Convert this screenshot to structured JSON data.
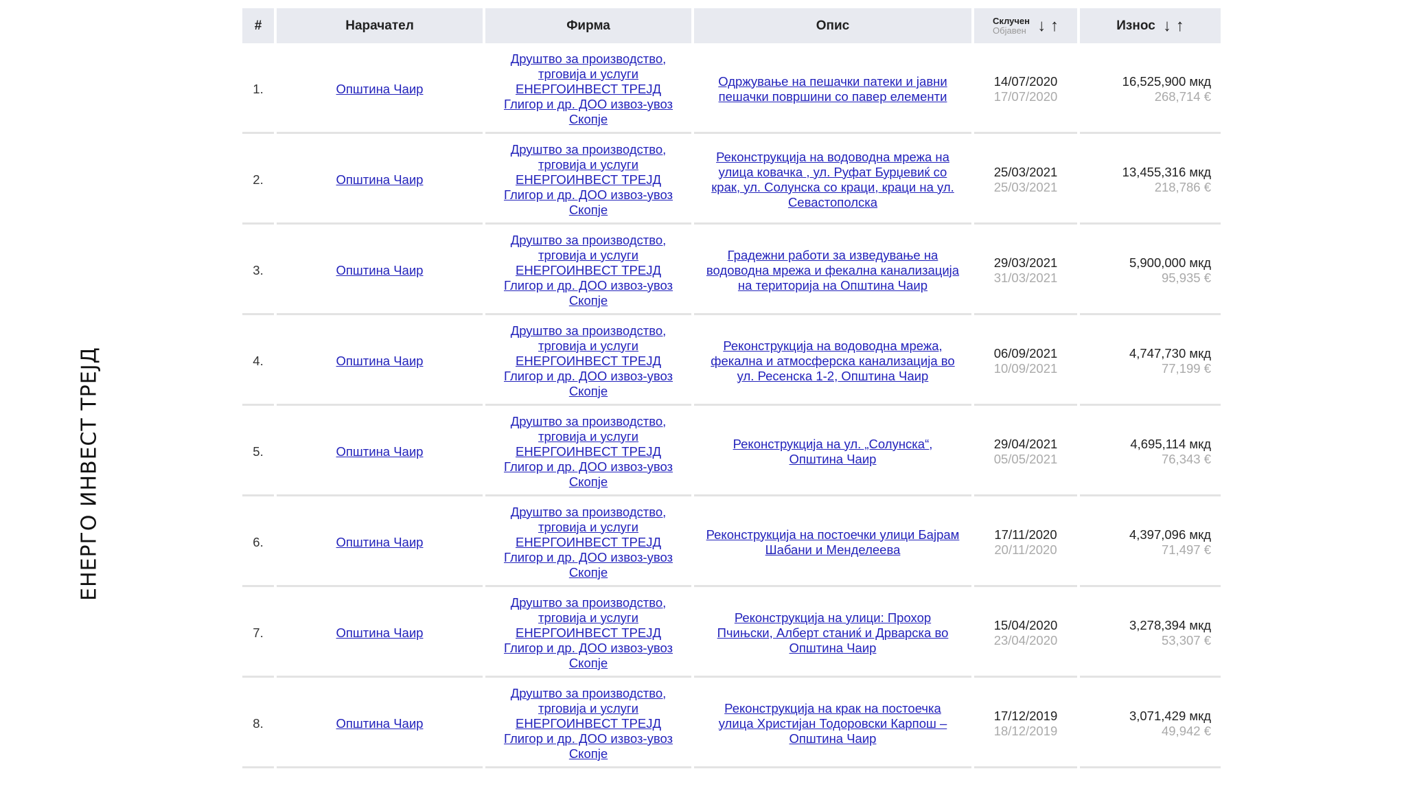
{
  "side_title": "ЕНЕРГО ИНВЕСТ ТРЕЈД",
  "headers": {
    "num": "#",
    "buyer": "Нарачател",
    "firm": "Фирма",
    "desc": "Опис",
    "date_main": "Склучен",
    "date_sub": "Објавен",
    "amount": "Износ",
    "arrow_down": "↓",
    "arrow_up": "↑"
  },
  "rows": [
    {
      "num": "1.",
      "buyer": "Општина Чаир",
      "firm": [
        "Друштво за производство,",
        "трговија и услуги",
        "ЕНЕРГОИНВЕСТ ТРЕЈД",
        "Глигор и др. ДОО извоз-увоз",
        "Скопје"
      ],
      "desc": [
        "Одржување на пешачки патеки и јавни",
        "пешачки површини со павер елементи"
      ],
      "signed": "14/07/2020",
      "published": "17/07/2020",
      "amount_mkd": "16,525,900 мкд",
      "amount_eur": "268,714 €"
    },
    {
      "num": "2.",
      "buyer": "Општина Чаир",
      "firm": [
        "Друштво за производство,",
        "трговија и услуги",
        "ЕНЕРГОИНВЕСТ ТРЕЈД",
        "Глигор и др. ДОО извоз-увоз",
        "Скопје"
      ],
      "desc": [
        "Реконструкција на водоводна мрежа на",
        "улица ковачка , ул. Руфат Бурџевиќ со",
        "крак, ул. Солунска со краци, краци на ул.",
        "Севастополска"
      ],
      "signed": "25/03/2021",
      "published": "25/03/2021",
      "amount_mkd": "13,455,316 мкд",
      "amount_eur": "218,786 €"
    },
    {
      "num": "3.",
      "buyer": "Општина Чаир",
      "firm": [
        "Друштво за производство,",
        "трговија и услуги",
        "ЕНЕРГОИНВЕСТ ТРЕЈД",
        "Глигор и др. ДОО извоз-увоз",
        "Скопје"
      ],
      "desc": [
        "Градежни работи за изведување на",
        "водоводна мрежа и фекална канализација",
        "на територија на Општина Чаир"
      ],
      "signed": "29/03/2021",
      "published": "31/03/2021",
      "amount_mkd": "5,900,000 мкд",
      "amount_eur": "95,935 €"
    },
    {
      "num": "4.",
      "buyer": "Општина Чаир",
      "firm": [
        "Друштво за производство,",
        "трговија и услуги",
        "ЕНЕРГОИНВЕСТ ТРЕЈД",
        "Глигор и др. ДОО извоз-увоз",
        "Скопје"
      ],
      "desc": [
        "Реконструкција на водоводна мрежа,",
        "фекална и атмосферска канализација во",
        "ул. Ресенска 1-2, Општина Чаир"
      ],
      "signed": "06/09/2021",
      "published": "10/09/2021",
      "amount_mkd": "4,747,730 мкд",
      "amount_eur": "77,199 €"
    },
    {
      "num": "5.",
      "buyer": "Општина Чаир",
      "firm": [
        "Друштво за производство,",
        "трговија и услуги",
        "ЕНЕРГОИНВЕСТ ТРЕЈД",
        "Глигор и др. ДОО извоз-увоз",
        "Скопје"
      ],
      "desc": [
        "Реконструкција на ул. „Солунска“,",
        "Општина Чаир"
      ],
      "signed": "29/04/2021",
      "published": "05/05/2021",
      "amount_mkd": "4,695,114 мкд",
      "amount_eur": "76,343 €"
    },
    {
      "num": "6.",
      "buyer": "Општина Чаир",
      "firm": [
        "Друштво за производство,",
        "трговија и услуги",
        "ЕНЕРГОИНВЕСТ ТРЕЈД",
        "Глигор и др. ДОО извоз-увоз",
        "Скопје"
      ],
      "desc": [
        "Реконструкција на постоечки улици Бајрам",
        "Шабани и Менделеева"
      ],
      "signed": "17/11/2020",
      "published": "20/11/2020",
      "amount_mkd": "4,397,096 мкд",
      "amount_eur": "71,497 €"
    },
    {
      "num": "7.",
      "buyer": "Општина Чаир",
      "firm": [
        "Друштво за производство,",
        "трговија и услуги",
        "ЕНЕРГОИНВЕСТ ТРЕЈД",
        "Глигор и др. ДОО извоз-увоз",
        "Скопје"
      ],
      "desc": [
        "Реконструкција на улици: Прохор",
        "Пчињски, Алберт станиќ и Дрварска во",
        "Општина Чаир"
      ],
      "signed": "15/04/2020",
      "published": "23/04/2020",
      "amount_mkd": "3,278,394 мкд",
      "amount_eur": "53,307 €"
    },
    {
      "num": "8.",
      "buyer": "Општина Чаир",
      "firm": [
        "Друштво за производство,",
        "трговија и услуги",
        "ЕНЕРГОИНВЕСТ ТРЕЈД",
        "Глигор и др. ДОО извоз-увоз",
        "Скопје"
      ],
      "desc": [
        "Реконструкција на крак на постоечка",
        "улица Христијан Тодоровски Карпош –",
        "Општина Чаир"
      ],
      "signed": "17/12/2019",
      "published": "18/12/2019",
      "amount_mkd": "3,071,429 мкд",
      "amount_eur": "49,942 €"
    }
  ]
}
